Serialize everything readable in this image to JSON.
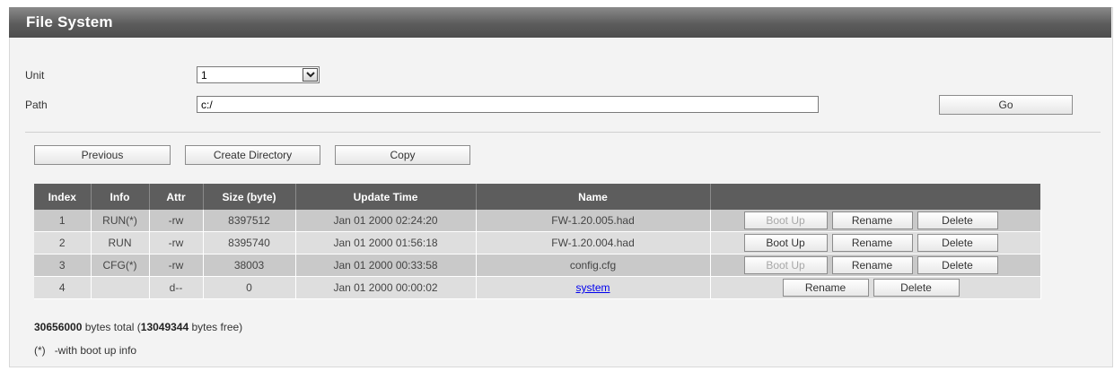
{
  "window": {
    "title": "File System"
  },
  "form": {
    "unit_label": "Unit",
    "unit_value": "1",
    "path_label": "Path",
    "path_value": "c:/",
    "go_label": "Go"
  },
  "toolbar": {
    "previous_label": "Previous",
    "create_directory_label": "Create Directory",
    "copy_label": "Copy"
  },
  "table": {
    "headers": [
      "Index",
      "Info",
      "Attr",
      "Size (byte)",
      "Update Time",
      "Name",
      ""
    ],
    "rows": [
      {
        "index": "1",
        "info": "RUN(*)",
        "attr": "-rw",
        "size": "8397512",
        "time": "Jan 01 2000 02:24:20",
        "name": "FW-1.20.005.had",
        "boot_up": "Boot Up",
        "boot_up_enabled": false,
        "rename": "Rename",
        "delete": "Delete"
      },
      {
        "index": "2",
        "info": "RUN",
        "attr": "-rw",
        "size": "8395740",
        "time": "Jan 01 2000 01:56:18",
        "name": "FW-1.20.004.had",
        "boot_up": "Boot Up",
        "boot_up_enabled": true,
        "rename": "Rename",
        "delete": "Delete"
      },
      {
        "index": "3",
        "info": "CFG(*)",
        "attr": "-rw",
        "size": "38003",
        "time": "Jan 01 2000 00:33:58",
        "name": "config.cfg",
        "boot_up": "Boot Up",
        "boot_up_enabled": false,
        "rename": "Rename",
        "delete": "Delete"
      },
      {
        "index": "4",
        "info": "",
        "attr": "d--",
        "size": "0",
        "time": "Jan 01 2000 00:00:02",
        "name": "system",
        "name_is_link": true,
        "rename": "Rename",
        "delete": "Delete"
      }
    ]
  },
  "summary": {
    "total_bytes": "30656000",
    "text_mid": " bytes total (",
    "free_bytes": "13049344",
    "text_end": " bytes free)"
  },
  "note": {
    "marker": "(*)",
    "text": "-with boot up info"
  }
}
